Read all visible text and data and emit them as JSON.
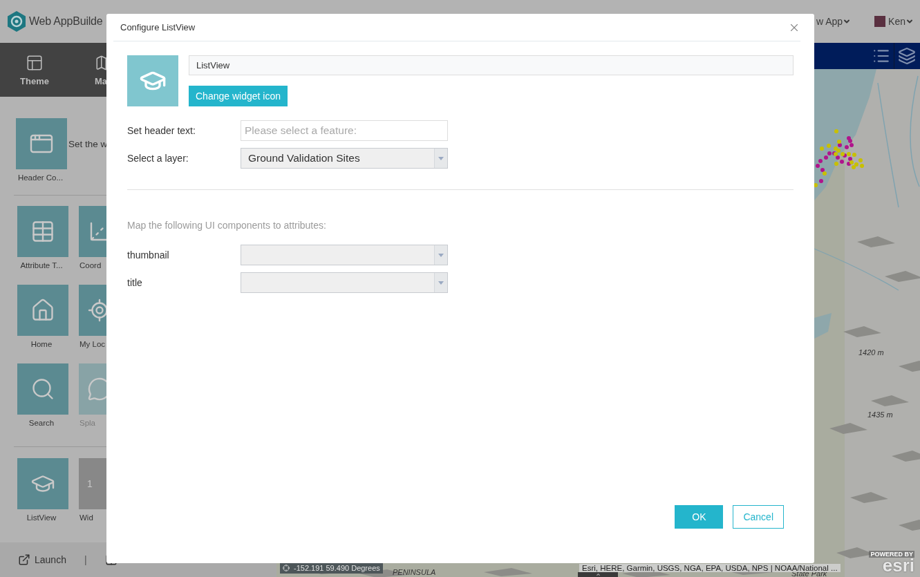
{
  "app": {
    "title": "Web AppBuilde",
    "header_menu": "w App",
    "user": "Ken"
  },
  "nav_tabs": [
    {
      "label": "Theme"
    },
    {
      "label": "Ma"
    }
  ],
  "widget_sections": [
    {
      "note": "Set the w",
      "tiles": [
        {
          "label": "Header Co...",
          "kind": "widget",
          "disabled": false
        }
      ]
    },
    {
      "tiles": [
        {
          "label": "Attribute T...",
          "kind": "widget",
          "disabled": false
        },
        {
          "label": "Coord",
          "kind": "widget",
          "disabled": false
        },
        {
          "label": "Home",
          "kind": "widget",
          "disabled": false
        },
        {
          "label": "My Loc",
          "kind": "widget",
          "disabled": false
        },
        {
          "label": "Search",
          "kind": "widget",
          "disabled": false
        },
        {
          "label": "Spla",
          "kind": "widget",
          "disabled": true
        }
      ]
    },
    {
      "tiles": [
        {
          "label": "ListView",
          "kind": "widget",
          "disabled": false
        },
        {
          "label": "Wid",
          "kind": "numbered",
          "text": "1",
          "disabled": false
        }
      ]
    }
  ],
  "bottom_bar": {
    "launch": "Launch",
    "separator": "|"
  },
  "map": {
    "labels": [
      "1420 m",
      "1435 m",
      "PENINSULA",
      "State Park"
    ],
    "coordinates": "-152.191 59.490 Degrees",
    "attribution": "Esri, HERE, Garmin, USGS, NGA, EPA, USDA, NPS | NOAA/National ...",
    "logo_top": "POWERED BY",
    "logo_word": "esri"
  },
  "dialog": {
    "title": "Configure ListView",
    "name_value": "ListView",
    "change_icon_button": "Change widget icon",
    "fields": [
      {
        "label": "Set header text:",
        "kind": "text",
        "placeholder": "Please select a feature:"
      },
      {
        "label": "Select a layer:",
        "kind": "select",
        "value": "Ground Validation Sites"
      }
    ],
    "mapping_heading": "Map the following UI components to attributes:",
    "mappings": [
      {
        "label": "thumbnail",
        "kind": "select"
      },
      {
        "label": "title",
        "kind": "select"
      }
    ],
    "buttons": [
      {
        "label": "OK",
        "kind": "primary"
      },
      {
        "label": "Cancel",
        "kind": "secondary"
      }
    ]
  }
}
